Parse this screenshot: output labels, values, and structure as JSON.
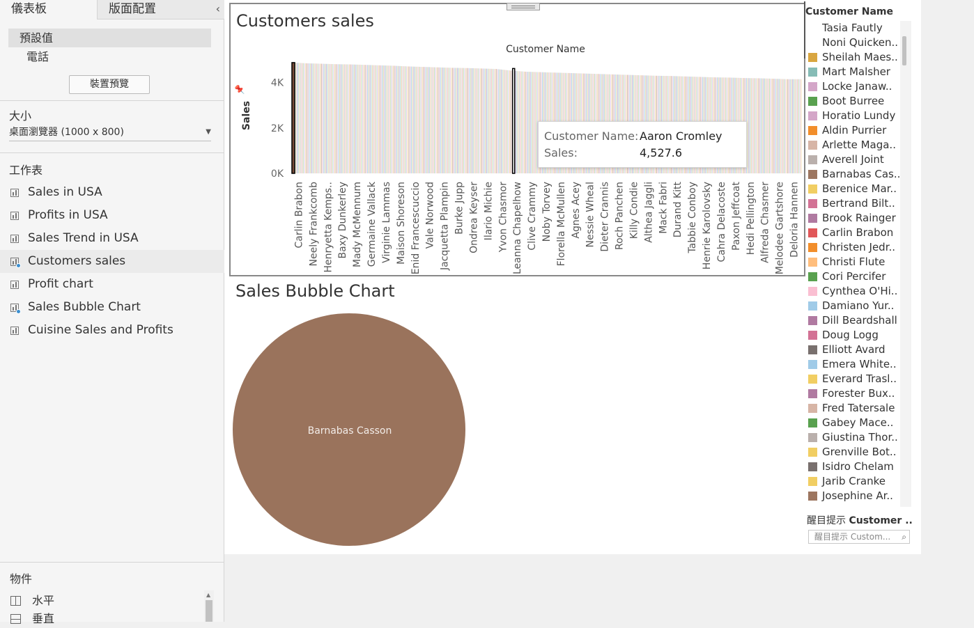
{
  "left_panel": {
    "tab_dashboard": "儀表板",
    "tab_layout": "版面配置",
    "device_default": "預設值",
    "device_phone": "電話",
    "device_preview_button": "裝置預覽",
    "size_label": "大小",
    "size_value": "桌面瀏覽器 (1000 x 800)",
    "sheets_label": "工作表",
    "sheets": [
      {
        "label": "Sales in USA",
        "in_use": false
      },
      {
        "label": "Profits in USA",
        "in_use": false
      },
      {
        "label": "Sales Trend in USA",
        "in_use": false
      },
      {
        "label": "Customers sales",
        "in_use": true
      },
      {
        "label": "Profit chart",
        "in_use": false
      },
      {
        "label": "Sales Bubble Chart",
        "in_use": true
      },
      {
        "label": "Cuisine Sales and Profits",
        "in_use": false
      }
    ],
    "objects_label": "物件",
    "objects": [
      "水平",
      "垂直"
    ]
  },
  "customers_sales": {
    "title": "Customers sales"
  },
  "tooltip": {
    "name_key": "Customer Name:",
    "name_value": "Aaron Cromley",
    "sales_key": "Sales:",
    "sales_value": "4,527.6"
  },
  "bubble": {
    "title": "Sales Bubble Chart"
  },
  "chart_data": [
    {
      "type": "bar",
      "title": "Customers sales",
      "xlabel": "Customer Name",
      "ylabel": "Sales",
      "ylim": [
        0,
        5000
      ],
      "yticks": [
        "0K",
        "2K",
        "4K"
      ],
      "ytick_values": [
        0,
        2000,
        4000
      ],
      "xtick_labels": [
        "Carlin Brabon",
        "Neely Frankcomb",
        "Henryetta Kemps..",
        "Baxy Dunkerley",
        "Mady McMennum",
        "Germaine Vallack",
        "Virginie Lammas",
        "Maison Shoreson",
        "Enid Francescuccio",
        "Vale Norwood",
        "Jacquetta Plampin",
        "Burke Jupp",
        "Ondrea Keyser",
        "Ilario Michie",
        "Yvon Chasmor",
        "Leanna Chapelhow",
        "Clive Crammy",
        "Noby Torvey",
        "Florella McMullen",
        "Agnes Acey",
        "Nessie Wheal",
        "Dieter Crannis",
        "Roch Panchen",
        "Killy Condie",
        "Althea Jaggli",
        "Mack Fabri",
        "Durand Kitt",
        "Tabbie Conboy",
        "Henrie Karolovsky",
        "Cahra Delacoste",
        "Paxon Jeffcoat",
        "Hedi Pellington",
        "Alfreda Chasmer",
        "Melodee Gartshore",
        "Deloria Hannen"
      ],
      "values": [
        4880,
        4850,
        4830,
        4810,
        4800,
        4780,
        4760,
        4740,
        4710,
        4690,
        4670,
        4650,
        4640,
        4620,
        4600,
        4527.6,
        4480,
        4460,
        4440,
        4420,
        4400,
        4380,
        4360,
        4340,
        4320,
        4300,
        4290,
        4270,
        4250,
        4230,
        4220,
        4200,
        4190,
        4170,
        4150
      ],
      "highlighted": [
        "Carlin Brabon",
        "Aaron Cromley"
      ],
      "bar_colors": [
        "#c7a79b",
        "#e3b8c8",
        "#9fc8e6",
        "#d6cd9a",
        "#b9a7d8",
        "#a8d4c6",
        "#e9c7a1",
        "#c9c9c9",
        "#f0b7b7",
        "#b6d7a8",
        "#d7c3e8",
        "#f2d39b"
      ]
    },
    {
      "type": "scatter",
      "title": "Sales Bubble Chart",
      "label": "Barnabas Casson",
      "color": "#9a735c"
    }
  ],
  "legend": {
    "title": "Customer Name",
    "items": [
      {
        "name": "Tasia Fautly",
        "color": "#ffffff"
      },
      {
        "name": "Noni Quicken..",
        "color": "#ffffff"
      },
      {
        "name": "Sheilah Maes..",
        "color": "#d9a640"
      },
      {
        "name": "Mart Malsher",
        "color": "#86bcb6"
      },
      {
        "name": "Locke Janaw..",
        "color": "#d4a6c8"
      },
      {
        "name": "Boot Burree",
        "color": "#59a14f"
      },
      {
        "name": "Horatio Lundy",
        "color": "#d4a6c8"
      },
      {
        "name": "Aldin Purrier",
        "color": "#f28e2b"
      },
      {
        "name": "Arlette Maga..",
        "color": "#d7b5a6"
      },
      {
        "name": "Averell Joint",
        "color": "#bab0ac"
      },
      {
        "name": "Barnabas Cas..",
        "color": "#9d7660"
      },
      {
        "name": "Berenice Mar..",
        "color": "#f1ce63"
      },
      {
        "name": "Bertrand Bilt..",
        "color": "#d37295"
      },
      {
        "name": "Brook Rainger",
        "color": "#b07aa1"
      },
      {
        "name": "Carlin Brabon",
        "color": "#e15759"
      },
      {
        "name": "Christen Jedr..",
        "color": "#f28e2b"
      },
      {
        "name": "Christi Flute",
        "color": "#ffbe7d"
      },
      {
        "name": "Cori Percifer",
        "color": "#59a14f"
      },
      {
        "name": "Cynthea O'Hi..",
        "color": "#fabfd2"
      },
      {
        "name": "Damiano Yur..",
        "color": "#a0cbe8"
      },
      {
        "name": "Dill Beardshall",
        "color": "#b07aa1"
      },
      {
        "name": "Doug Logg",
        "color": "#d37295"
      },
      {
        "name": "Elliott Avard",
        "color": "#79706e"
      },
      {
        "name": "Emera White..",
        "color": "#a0cbe8"
      },
      {
        "name": "Everard Trasl..",
        "color": "#f1ce63"
      },
      {
        "name": "Forester Bux..",
        "color": "#b07aa1"
      },
      {
        "name": "Fred Tatersale",
        "color": "#d7b5a6"
      },
      {
        "name": "Gabey Mace..",
        "color": "#59a14f"
      },
      {
        "name": "Giustina Thor..",
        "color": "#bab0ac"
      },
      {
        "name": "Grenville Bot..",
        "color": "#f1ce63"
      },
      {
        "name": "Isidro Chelam",
        "color": "#79706e"
      },
      {
        "name": "Jarib Cranke",
        "color": "#f1ce63"
      },
      {
        "name": "Josephine Ar..",
        "color": "#9d7660"
      }
    ],
    "highlight_label": "醒目提示",
    "highlight_field": "Customer ..",
    "highlight_placeholder": "醒目提示 Custom..."
  }
}
